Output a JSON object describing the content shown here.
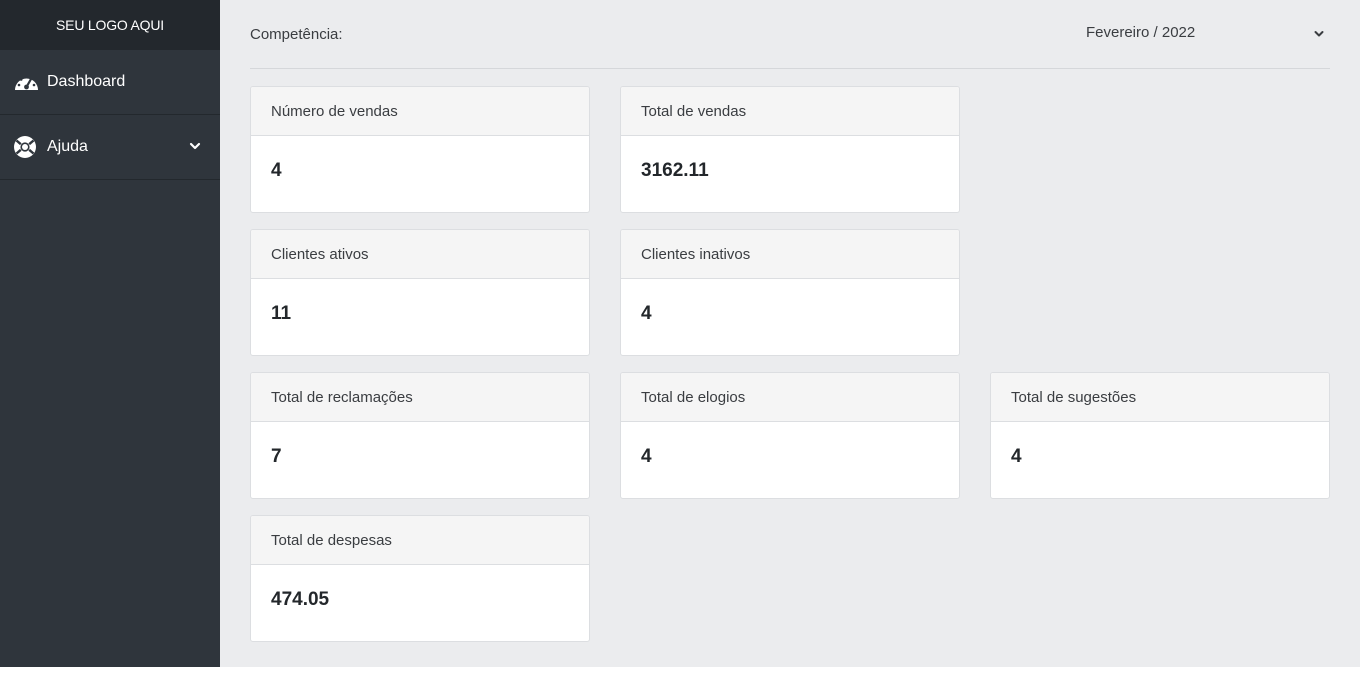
{
  "sidebar": {
    "logo": "SEU LOGO AQUI",
    "items": [
      {
        "label": "Dashboard",
        "icon": "dashboard-gauge-icon"
      },
      {
        "label": "Ajuda",
        "icon": "lifebuoy-icon",
        "has_submenu": true
      }
    ]
  },
  "competencia": {
    "label": "Competência:",
    "selected": "Fevereiro / 2022"
  },
  "cards": [
    {
      "title": "Número de vendas",
      "value": "4"
    },
    {
      "title": "Total de vendas",
      "value": "3162.11"
    },
    {
      "title": "Clientes ativos",
      "value": "11"
    },
    {
      "title": "Clientes inativos",
      "value": "4"
    },
    {
      "title": "Total de reclamações",
      "value": "7"
    },
    {
      "title": "Total de elogios",
      "value": "4"
    },
    {
      "title": "Total de sugestões",
      "value": "4"
    },
    {
      "title": "Total de despesas",
      "value": "474.05"
    }
  ],
  "colors": {
    "sidebar_bg": "#2f353c",
    "logo_bg": "#23282d",
    "page_bg": "#ebecee",
    "card_header_bg": "#f5f5f5"
  }
}
